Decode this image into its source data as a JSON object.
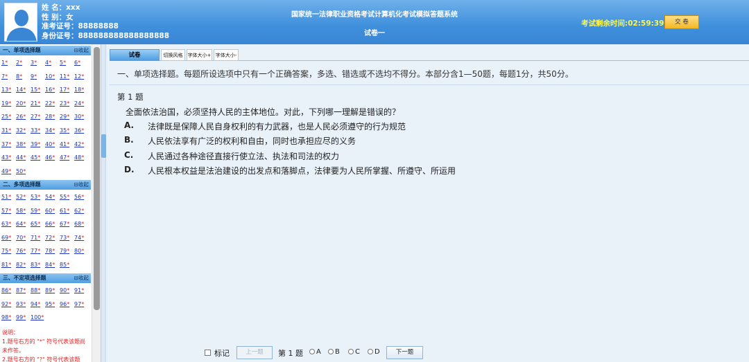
{
  "candidate": {
    "name_line": "姓 名：xxx",
    "gender_line": "性 别：女",
    "exam_no_line": "准考证号：88888888",
    "id_no_line": "身份证号：888888888888888888"
  },
  "header": {
    "system_title": "国家统一法律职业资格考试计算机化考试模拟答题系统",
    "paper_title": "试卷一",
    "timer": "考试剩余时间:02:59:39",
    "submit_label": "交 卷"
  },
  "sidebar": {
    "collapse_label": "⊟收起",
    "sections": [
      {
        "title": "一、单项选择题",
        "rows": [
          [
            "1",
            "2",
            "3",
            "4",
            "5",
            "6"
          ],
          [
            "7",
            "8",
            "9",
            "10",
            "11",
            "12"
          ],
          [
            "13",
            "14",
            "15",
            "16",
            "17",
            "18"
          ],
          [
            "19",
            "20",
            "21",
            "22",
            "23",
            "24"
          ],
          [
            "25",
            "26",
            "27",
            "28",
            "29",
            "30"
          ],
          [
            "31",
            "32",
            "33",
            "34",
            "35",
            "36"
          ],
          [
            "37",
            "38",
            "39",
            "40",
            "41",
            "42"
          ],
          [
            "43",
            "44",
            "45",
            "46",
            "47",
            "48"
          ],
          [
            "49",
            "50"
          ]
        ]
      },
      {
        "title": "二、多项选择题",
        "rows": [
          [
            "51",
            "52",
            "53",
            "54",
            "55",
            "56"
          ],
          [
            "57",
            "58",
            "59",
            "60",
            "61",
            "62"
          ],
          [
            "63",
            "64",
            "65",
            "66",
            "67",
            "68"
          ],
          [
            "69",
            "70",
            "71",
            "72",
            "73",
            "74"
          ],
          [
            "75",
            "76",
            "77",
            "78",
            "79",
            "80"
          ],
          [
            "81",
            "82",
            "83",
            "84",
            "85"
          ]
        ]
      },
      {
        "title": "三、不定项选择题",
        "rows": [
          [
            "86",
            "87",
            "88",
            "89",
            "90",
            "91"
          ],
          [
            "92",
            "93",
            "94",
            "95",
            "96",
            "97"
          ],
          [
            "98",
            "99",
            "100"
          ]
        ]
      }
    ],
    "note": {
      "title": "说明：",
      "line1": "1.题号右方的 \"*\" 符号代表该题尚未作答。",
      "line2": "2.题号右方的 \"?\" 符号代表该题"
    }
  },
  "tabs": {
    "paper": "试卷",
    "switch_style": "切换风格",
    "font_larger": "字体大小+",
    "font_smaller": "字体大小-"
  },
  "section_desc": "一、单项选择题。每题所设选项中只有一个正确答案，多选、错选或不选均不得分。本部分含1—50题，每题1分，共50分。",
  "question": {
    "number_label": "第 1 题",
    "text": "全面依法治国，必须坚持人民的主体地位。对此，下列哪一理解是错误的？",
    "options": [
      {
        "letter": "A.",
        "text": "法律既是保障人民自身权利的有力武器，也是人民必须遵守的行为规范"
      },
      {
        "letter": "B.",
        "text": "人民依法享有广泛的权利和自由，同时也承担应尽的义务"
      },
      {
        "letter": "C.",
        "text": "人民通过各种途径直接行使立法、执法和司法的权力"
      },
      {
        "letter": "D.",
        "text": "人民根本权益是法治建设的出发点和落脚点，法律要为人民所掌握、所遵守、所运用"
      }
    ]
  },
  "nav": {
    "mark_label": "标记",
    "prev_label": "上一题",
    "current": "第 1 题",
    "answer_a": "A",
    "answer_b": "B",
    "answer_c": "C",
    "answer_d": "D",
    "next_label": "下一题"
  }
}
